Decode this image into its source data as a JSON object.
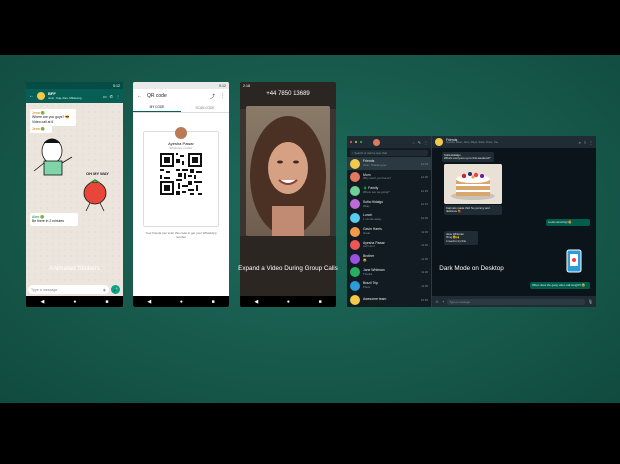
{
  "captions": [
    "Animated Stickers",
    "QR Codes",
    "Expand a Video During Group Calls",
    "Dark Mode on Desktop"
  ],
  "phone1": {
    "chat_title": "BFF",
    "chat_subtitle": "Jenn, Yuja, Alex, Mikasong",
    "msg1_sender": "Jenn 🟢",
    "msg1_text": "Where are you guys? 😎 Video call at 6",
    "msg2_sender": "Jenn 🟢",
    "sticker_text": "OH MY WAY",
    "msg3_sender": "Alex 🟢",
    "msg3_text": "Be there in 2 minutes",
    "input_placeholder": "Type a message",
    "time": "5:12"
  },
  "phone2": {
    "title": "QR code",
    "tab_mine": "MY CODE",
    "tab_scan": "SCAN CODE",
    "name": "Ayesha Pawar",
    "subtitle": "WhatsApp contact",
    "footer": "Your friends can scan this code to get your WhatsApp number",
    "time": "5:12"
  },
  "phone3": {
    "number": "+44 7850 13689",
    "time": "2:18"
  },
  "desktop": {
    "search": "Search or start a new chat",
    "chats": [
      {
        "name": "Friends",
        "preview": "Jenn: Thanks guys",
        "time": "12:34",
        "color": "#f2c94c"
      },
      {
        "name": "Mom",
        "preview": "Why aren't you home?",
        "time": "12:30",
        "color": "#e07a5f"
      },
      {
        "name": "🌲 Family",
        "preview": "Where are we going?",
        "time": "12:25",
        "color": "#6fcf97"
      },
      {
        "name": "Sofia Hidalgo",
        "preview": "Okay",
        "time": "12:10",
        "color": "#bb6bd9"
      },
      {
        "name": "Lunch",
        "preview": "1 minute away",
        "time": "12:02",
        "color": "#56ccf2"
      },
      {
        "name": "Gavin Harris",
        "preview": "Great",
        "time": "11:45",
        "color": "#f2994a"
      },
      {
        "name": "Ayesha Pawar",
        "preview": "Let's do it",
        "time": "11:40",
        "color": "#eb5757"
      },
      {
        "name": "Brother",
        "preview": "😂",
        "time": "11:30",
        "color": "#9b51e0"
      },
      {
        "name": "Jane Whitman",
        "preview": "Thanks",
        "time": "11:20",
        "color": "#27ae60"
      },
      {
        "name": "Brazil Trip",
        "preview": "Photo",
        "time": "11:05",
        "color": "#2d9cdb"
      },
      {
        "name": "Awesome team",
        "preview": "",
        "time": "10:50",
        "color": "#f2c94c"
      }
    ],
    "chat_title": "Friends",
    "chat_subtitle": "Ayesha, Brian, Jane, Maya, Sofia, Vince, You",
    "bubbles": [
      {
        "text": "Sofia Hidalgo\nWhat's everyone up to this weekend?",
        "dir": "in"
      },
      {
        "text": "Carmelo made this! So yummy and delicious 🍓",
        "dir": "in"
      },
      {
        "text": "Looks amazing! 😍",
        "dir": "out"
      },
      {
        "text": "Jane Whitman\nOmg 😂🙌\nI need to try this",
        "dir": "in"
      },
      {
        "text": "When does the gang video call tonight? 😂",
        "dir": "out"
      }
    ],
    "input_placeholder": "Type a message"
  }
}
